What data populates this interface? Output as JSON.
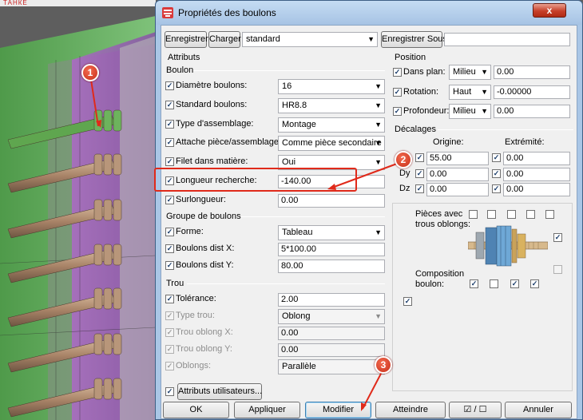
{
  "dialog": {
    "title": "Propriétés des boulons",
    "close_label": "x"
  },
  "toolbar": {
    "save_label": "Enregistrer",
    "load_label": "Charger",
    "preset_value": "standard",
    "save_as_label": "Enregistrer Sous",
    "save_as_value": ""
  },
  "attributes": {
    "heading": "Attributs",
    "bolt_section": "Boulon",
    "rows": [
      {
        "label": "Diamètre boulons:",
        "value": "16",
        "checked": true,
        "kind": "combo"
      },
      {
        "label": "Standard boulons:",
        "value": "HR8.8",
        "checked": true,
        "kind": "combo"
      },
      {
        "label": "Type d'assemblage:",
        "value": "Montage",
        "checked": true,
        "kind": "combo"
      },
      {
        "label": "Attache pièce/assemblage:",
        "value": "Comme pièce secondaire",
        "checked": true,
        "kind": "combo"
      },
      {
        "label": "Filet dans matière:",
        "value": "Oui",
        "checked": true,
        "kind": "combo"
      },
      {
        "label": "Longueur recherche:",
        "value": "-140.00",
        "checked": true,
        "kind": "input"
      },
      {
        "label": "Surlongueur:",
        "value": "0.00",
        "checked": true,
        "kind": "input"
      }
    ],
    "group_section": "Groupe de boulons",
    "group_rows": [
      {
        "label": "Forme:",
        "value": "Tableau",
        "checked": true,
        "kind": "combo"
      },
      {
        "label": "Boulons dist X:",
        "value": "5*100.00",
        "checked": true,
        "kind": "input"
      },
      {
        "label": "Boulons dist Y:",
        "value": "80.00",
        "checked": true,
        "kind": "input"
      }
    ],
    "hole_section": "Trou",
    "hole_rows": [
      {
        "label": "Tolérance:",
        "value": "2.00",
        "checked": true,
        "kind": "input",
        "disabled": false
      },
      {
        "label": "Type trou:",
        "value": "Oblong",
        "checked": true,
        "kind": "combo",
        "disabled": true
      },
      {
        "label": "Trou oblong X:",
        "value": "0.00",
        "checked": true,
        "kind": "input",
        "disabled": true
      },
      {
        "label": "Trou oblong Y:",
        "value": "0.00",
        "checked": true,
        "kind": "input",
        "disabled": true
      },
      {
        "label": "Oblongs:",
        "value": "Parallèle",
        "checked": true,
        "kind": "combo",
        "disabled": true
      }
    ],
    "user_attributes_label": "Attributs utilisateurs..."
  },
  "position": {
    "heading": "Position",
    "rows": [
      {
        "label": "Dans plan:",
        "combo": "Milieu",
        "value": "0.00"
      },
      {
        "label": "Rotation:",
        "combo": "Haut",
        "value": "-0.00000"
      },
      {
        "label": "Profondeur:",
        "combo": "Milieu",
        "value": "0.00"
      }
    ]
  },
  "offsets": {
    "heading": "Décalages",
    "origin_label": "Origine:",
    "end_label": "Extrémité:",
    "rows": [
      {
        "axis": "Dx",
        "origin": "55.00",
        "end": "0.00"
      },
      {
        "axis": "Dy",
        "origin": "0.00",
        "end": "0.00"
      },
      {
        "axis": "Dz",
        "origin": "0.00",
        "end": "0.00"
      }
    ]
  },
  "preview": {
    "slotted_label_1": "Pièces avec",
    "slotted_label_2": "trous oblongs:",
    "composition_label_1": "Composition",
    "composition_label_2": "boulon:"
  },
  "footer": {
    "ok": "OK",
    "apply": "Appliquer",
    "modify": "Modifier",
    "get": "Atteindre",
    "toggle": "☑ / ☐",
    "cancel": "Annuler"
  },
  "callouts": [
    "1",
    "2",
    "3"
  ],
  "top_strip_text": "ТАНКЕ"
}
